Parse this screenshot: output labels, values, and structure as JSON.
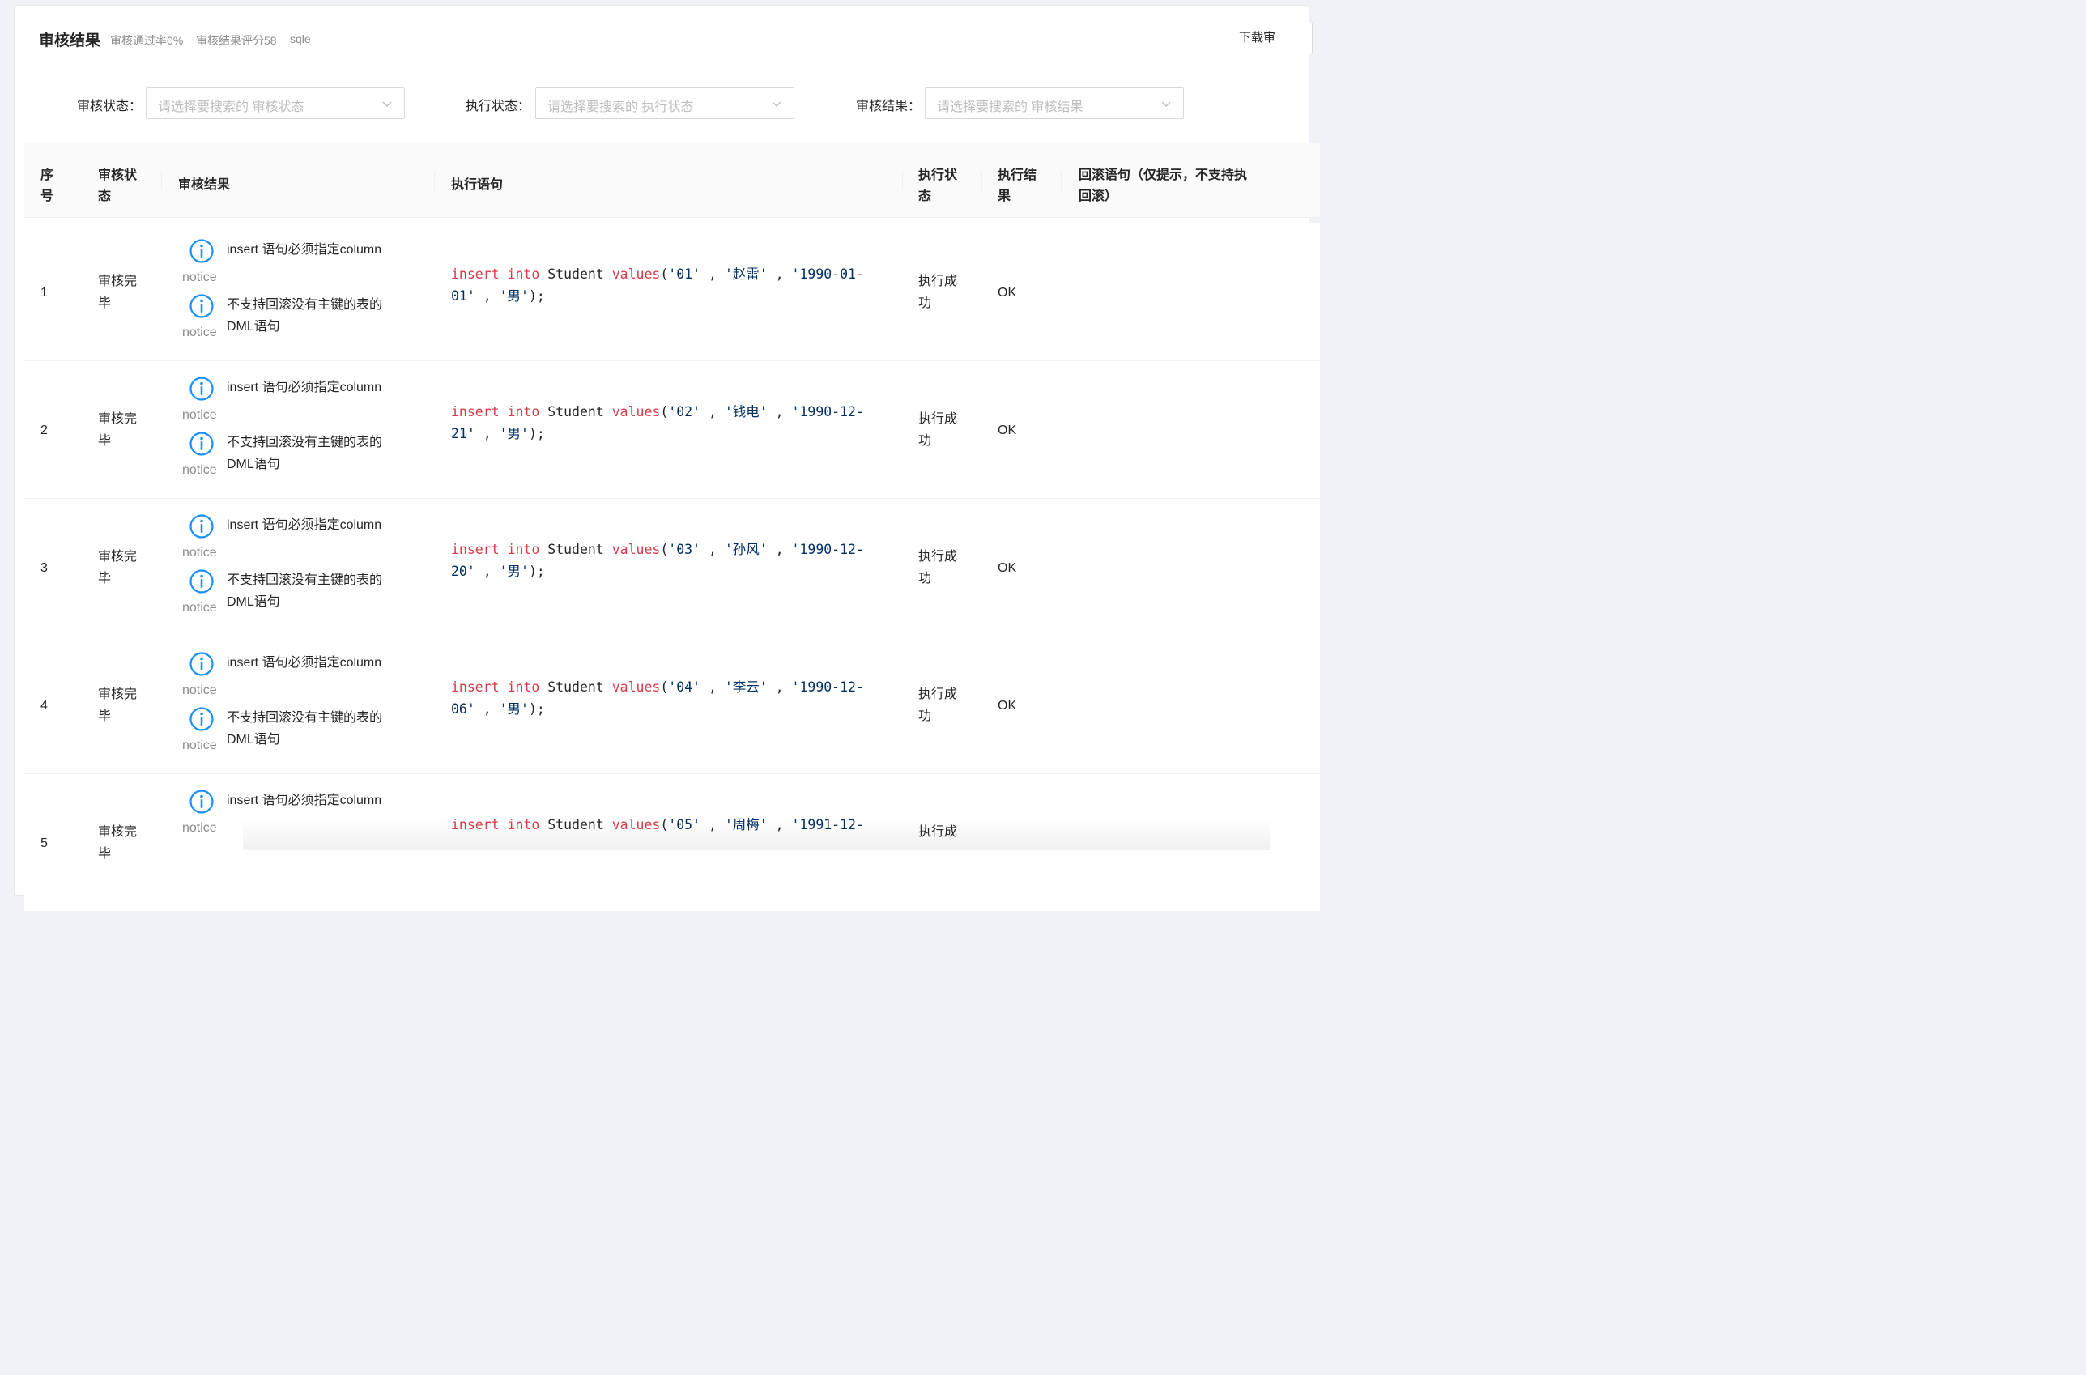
{
  "card": {
    "title": "审核结果",
    "pass_rate": "审核通过率0%",
    "score": "审核结果评分58",
    "instance": "sqle",
    "download_label": "下载审"
  },
  "filters": [
    {
      "label": "审核状态：",
      "placeholder": "请选择要搜索的 审核状态"
    },
    {
      "label": "执行状态：",
      "placeholder": "请选择要搜索的 执行状态"
    },
    {
      "label": "审核结果：",
      "placeholder": "请选择要搜索的 审核结果"
    }
  ],
  "table": {
    "headers": {
      "index": [
        "序",
        "号"
      ],
      "audit_status": [
        "审核状",
        "态"
      ],
      "audit_result": "审核结果",
      "exec_sql": "执行语句",
      "exec_status": [
        "执行状",
        "态"
      ],
      "exec_result": [
        "执行结",
        "果"
      ],
      "rollback": [
        "回滚语句（仅提示，不支持执",
        "回滚）"
      ]
    },
    "rows": [
      {
        "index": "1",
        "audit_status": [
          "审核完",
          "毕"
        ],
        "issues": [
          {
            "level": "notice",
            "lines": [
              "insert 语句必须指定column"
            ]
          },
          {
            "level": "notice",
            "lines": [
              "不支持回滚没有主键的表的",
              "DML语句"
            ]
          }
        ],
        "sql": {
          "id": "'01'",
          "name": "'赵雷'",
          "date_a": "'1990-01-",
          "date_b": "01'",
          "sex": "'男'"
        },
        "exec_status": [
          "执行成",
          "功"
        ],
        "exec_result": "OK"
      },
      {
        "index": "2",
        "audit_status": [
          "审核完",
          "毕"
        ],
        "issues": [
          {
            "level": "notice",
            "lines": [
              "insert 语句必须指定column"
            ]
          },
          {
            "level": "notice",
            "lines": [
              "不支持回滚没有主键的表的",
              "DML语句"
            ]
          }
        ],
        "sql": {
          "id": "'02'",
          "name": "'钱电'",
          "date_a": "'1990-12-",
          "date_b": "21'",
          "sex": "'男'"
        },
        "exec_status": [
          "执行成",
          "功"
        ],
        "exec_result": "OK"
      },
      {
        "index": "3",
        "audit_status": [
          "审核完",
          "毕"
        ],
        "issues": [
          {
            "level": "notice",
            "lines": [
              "insert 语句必须指定column"
            ]
          },
          {
            "level": "notice",
            "lines": [
              "不支持回滚没有主键的表的",
              "DML语句"
            ]
          }
        ],
        "sql": {
          "id": "'03'",
          "name": "'孙风'",
          "date_a": "'1990-12-",
          "date_b": "20'",
          "sex": "'男'"
        },
        "exec_status": [
          "执行成",
          "功"
        ],
        "exec_result": "OK"
      },
      {
        "index": "4",
        "audit_status": [
          "审核完",
          "毕"
        ],
        "issues": [
          {
            "level": "notice",
            "lines": [
              "insert 语句必须指定column"
            ]
          },
          {
            "level": "notice",
            "lines": [
              "不支持回滚没有主键的表的",
              "DML语句"
            ]
          }
        ],
        "sql": {
          "id": "'04'",
          "name": "'李云'",
          "date_a": "'1990-12-",
          "date_b": "06'",
          "sex": "'男'"
        },
        "exec_status": [
          "执行成",
          "功"
        ],
        "exec_result": "OK"
      },
      {
        "index": "5",
        "audit_status": [
          "审核完",
          "毕"
        ],
        "issues": [
          {
            "level": "notice",
            "lines": [
              "insert 语句必须指定column"
            ]
          }
        ],
        "sql": {
          "id": "'05'",
          "name": "'周梅'",
          "date_a": "'1991-12-",
          "date_b": "",
          "sex": ""
        },
        "exec_status": [
          "执行成",
          ""
        ],
        "exec_result": ""
      }
    ],
    "sql_parts": {
      "insert": "insert",
      "into": "into",
      "table": "Student",
      "values": "values",
      "open": "(",
      "sep": " , ",
      "close": ");"
    }
  },
  "icons": {
    "info": "info-circle-icon",
    "dropdown": "chevron-down-icon"
  },
  "colors": {
    "info_icon": "#1890ff",
    "sql_keyword": "#d73a49",
    "sql_string": "#032f62"
  }
}
